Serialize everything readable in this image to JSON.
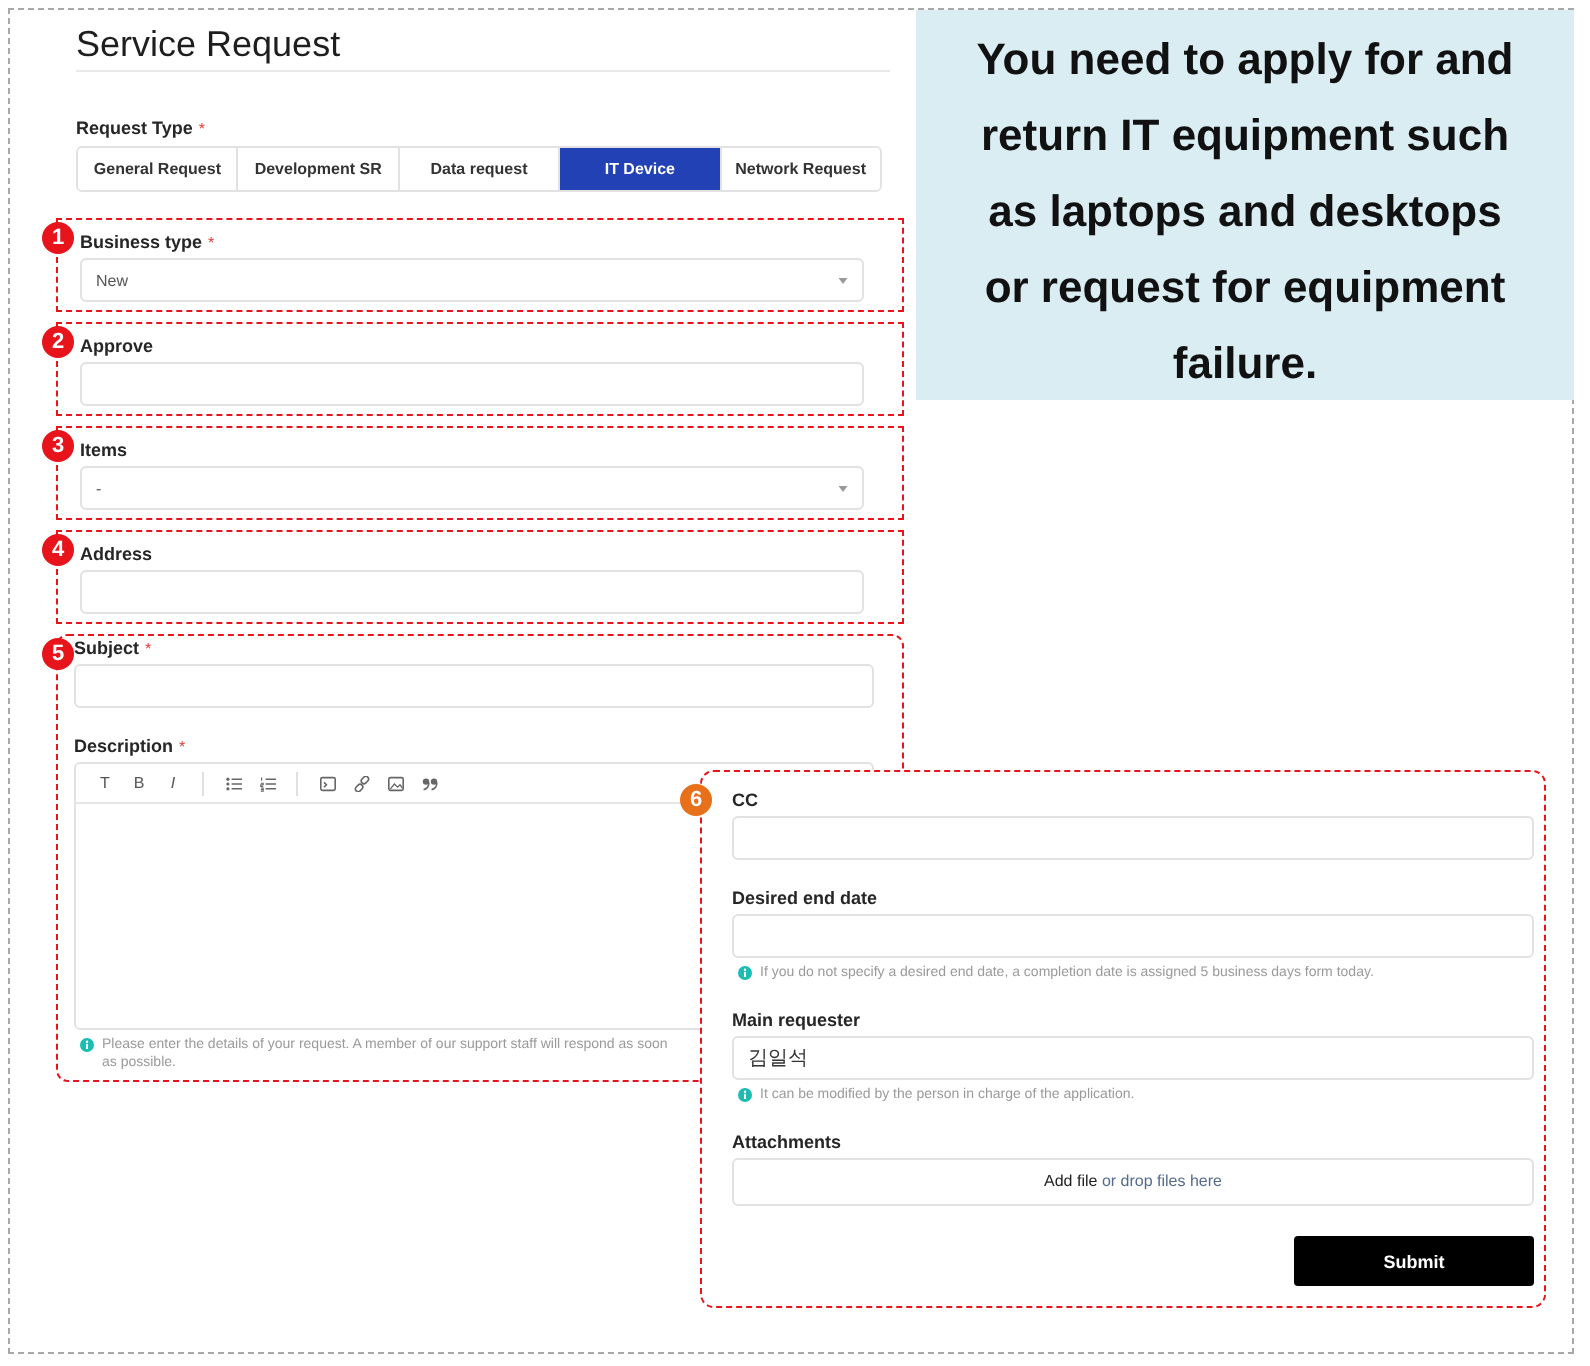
{
  "header": {
    "title": "Service Request"
  },
  "request_type": {
    "label": "Request Type",
    "required_mark": "*",
    "tabs": [
      {
        "label": "General Request",
        "selected": false
      },
      {
        "label": "Development SR",
        "selected": false
      },
      {
        "label": "Data request",
        "selected": false
      },
      {
        "label": "IT Device",
        "selected": true
      },
      {
        "label": "Network Request",
        "selected": false
      }
    ]
  },
  "sections": [
    {
      "marker": "1",
      "fields": [
        {
          "kind": "select",
          "label": "Business type",
          "required_mark": "*",
          "value": "New"
        }
      ]
    },
    {
      "marker": "2",
      "fields": [
        {
          "kind": "text",
          "label": "Approve"
        }
      ]
    },
    {
      "marker": "3",
      "fields": [
        {
          "kind": "select",
          "label": "Items",
          "value": "-"
        }
      ]
    },
    {
      "marker": "4",
      "fields": [
        {
          "kind": "text",
          "label": "Address"
        }
      ]
    },
    {
      "marker": "5",
      "fields": [
        {
          "kind": "text",
          "label": "Subject",
          "required_mark": "*"
        },
        {
          "kind": "editor",
          "label": "Description",
          "required_mark": "*",
          "toolbar": [
            {
              "kind": "heading",
              "text": "T"
            },
            {
              "kind": "bold",
              "text": "B"
            },
            {
              "kind": "italic",
              "text": "I"
            }
          ],
          "help": "Please enter the details of your request. A member of our support staff will respond as soon as possible."
        }
      ]
    }
  ],
  "panel": {
    "marker": "6",
    "fields": [
      {
        "kind": "text",
        "label": "CC"
      },
      {
        "kind": "text",
        "label": "Desired end date",
        "help": "If you do not specify a desired end date, a completion date is assigned 5 business days form today."
      },
      {
        "kind": "text",
        "label": "Main requester",
        "value": "김일석",
        "help": "It can be modified by the person in charge of the application."
      },
      {
        "kind": "upload",
        "label": "Attachments",
        "action": "Add file",
        "hint": "or drop files here"
      }
    ],
    "submit": "Submit"
  },
  "callout": {
    "text": "You need to apply for and return IT equipment such as laptops and desktops or request for equipment failure."
  }
}
